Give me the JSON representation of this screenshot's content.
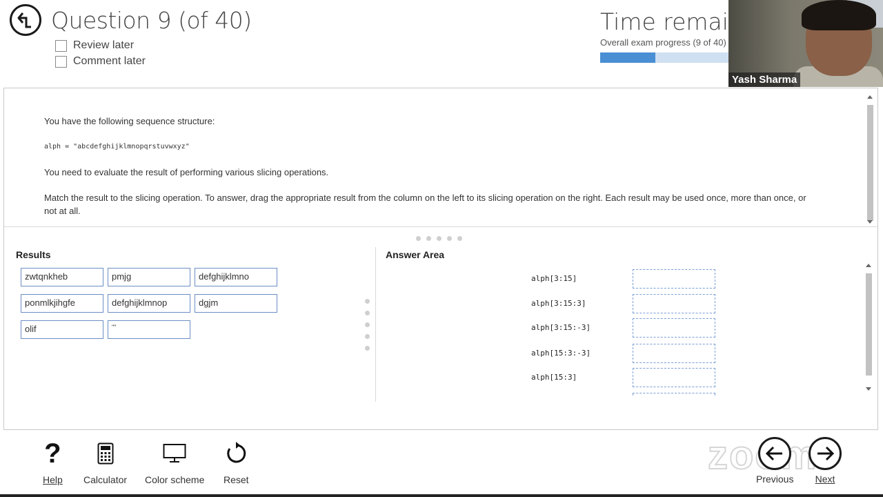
{
  "header": {
    "question_title": "Question 9 (of 40)",
    "review_later": "Review later",
    "comment_later": "Comment later",
    "time_remaining": "Time remaining",
    "progress_label": "Overall exam progress (9 of 40)",
    "progress_fraction": 0.225
  },
  "webcam": {
    "participant_name": "Yash Sharma"
  },
  "question": {
    "line1": "You have the following sequence structure:",
    "code": "alph = \"abcdefghijklmnopqrstuvwxyz\"",
    "line2": "You need to evaluate the result of performing various slicing operations.",
    "line3": "Match the result to the slicing operation. To answer, drag the appropriate result from the column on the left to its slicing operation on the right. Each result may be used once, more than once, or not at all."
  },
  "results": {
    "heading": "Results",
    "items": [
      "zwtqnkheb",
      "pmjg",
      "defghijklmno",
      "ponmlkjihgfe",
      "defghijklmnop",
      "dgjm",
      "olif",
      "\"\""
    ]
  },
  "answer_area": {
    "heading": "Answer Area",
    "operations": [
      "alph[3:15]",
      "alph[3:15:3]",
      "alph[3:15:-3]",
      "alph[15:3:-3]",
      "alph[15:3]"
    ]
  },
  "toolbar": {
    "help": "Help",
    "calculator": "Calculator",
    "color_scheme": "Color scheme",
    "reset": "Reset",
    "previous": "Previous",
    "next": "Next"
  },
  "watermark": "zoom"
}
